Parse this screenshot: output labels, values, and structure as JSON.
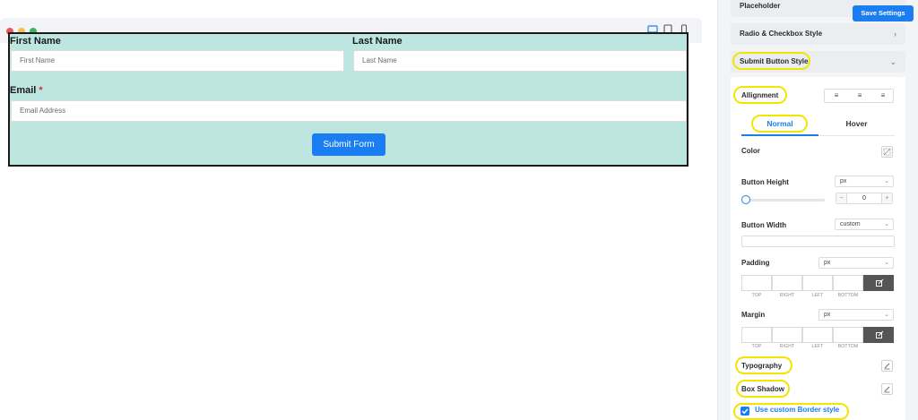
{
  "preview": {
    "device_icons": [
      "desktop-icon",
      "tablet-icon",
      "mobile-icon"
    ],
    "form": {
      "first_name_label": "First Name",
      "first_name_placeholder": "First Name",
      "last_name_label": "Last Name",
      "last_name_placeholder": "Last Name",
      "email_label": "Email",
      "email_required_mark": "*",
      "email_placeholder": "Email Address",
      "submit_label": "Submit Form"
    }
  },
  "panel": {
    "save_label": "Save Settings",
    "sections": {
      "placeholder": "Placeholder",
      "radio_checkbox": "Radio & Checkbox Style",
      "submit_button": "Submit Button Style"
    },
    "alignment_label": "Allignment",
    "alignment_options": [
      "≡",
      "≡",
      "≡"
    ],
    "tabs": {
      "normal": "Normal",
      "hover": "Hover"
    },
    "color_label": "Color",
    "button_height": {
      "label": "Button Height",
      "unit": "px",
      "value": "0",
      "minus": "−",
      "plus": "+"
    },
    "button_width": {
      "label": "Button Width",
      "unit": "custom"
    },
    "padding": {
      "label": "Padding",
      "unit": "px",
      "sides": [
        "TOP",
        "RIGHT",
        "LEFT",
        "BOTTOM"
      ]
    },
    "margin": {
      "label": "Margin",
      "unit": "px",
      "sides": [
        "TOP",
        "RIGHT",
        "LEFT",
        "BOTTOM"
      ]
    },
    "typography_label": "Typography",
    "box_shadow_label": "Box Shadow",
    "custom_border_label": "Use custom Border style"
  },
  "colors": {
    "accent": "#1a7ef2",
    "form_bg": "#bde6e1",
    "highlight": "#f2e600"
  }
}
